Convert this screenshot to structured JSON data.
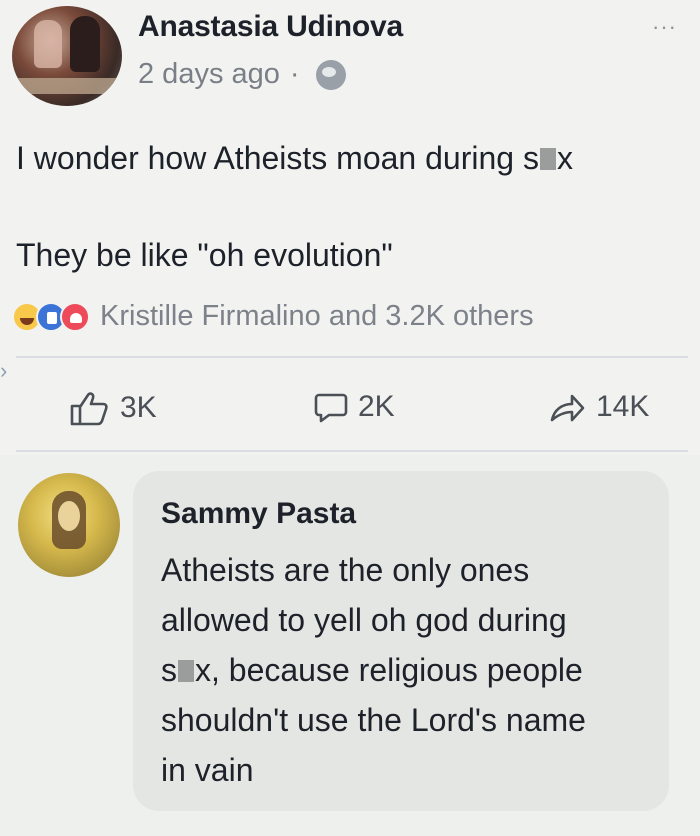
{
  "post": {
    "author": "Anastasia Udinova",
    "timestamp": "2 days ago",
    "separator": "·",
    "privacy_icon": "globe-icon",
    "more_label": "···",
    "line1_before": "I wonder how Atheists moan during s",
    "line1_after": "x",
    "line2": "They be like \"oh evolution\"",
    "reactions": {
      "icons": [
        "haha-reaction-icon",
        "like-reaction-icon",
        "love-reaction-icon"
      ],
      "text": "Kristille Firmalino and 3.2K others"
    },
    "actions": {
      "like_count": "3K",
      "comment_count": "2K",
      "share_count": "14K"
    }
  },
  "comment": {
    "author": "Sammy Pasta",
    "lines": {
      "l1": "Atheists are the only ones",
      "l2": "allowed to yell oh god during",
      "l3_before": "s",
      "l3_after": "x, because religious people",
      "l4": "shouldn't use the Lord's name",
      "l5": "in vain"
    }
  },
  "colors": {
    "background": "#eef0ee",
    "bubble": "#e4e6e3",
    "muted_text": "#7d828a",
    "reaction_like": "#3b74d6",
    "reaction_love": "#ee4b5a",
    "reaction_haha": "#f7c84a"
  }
}
